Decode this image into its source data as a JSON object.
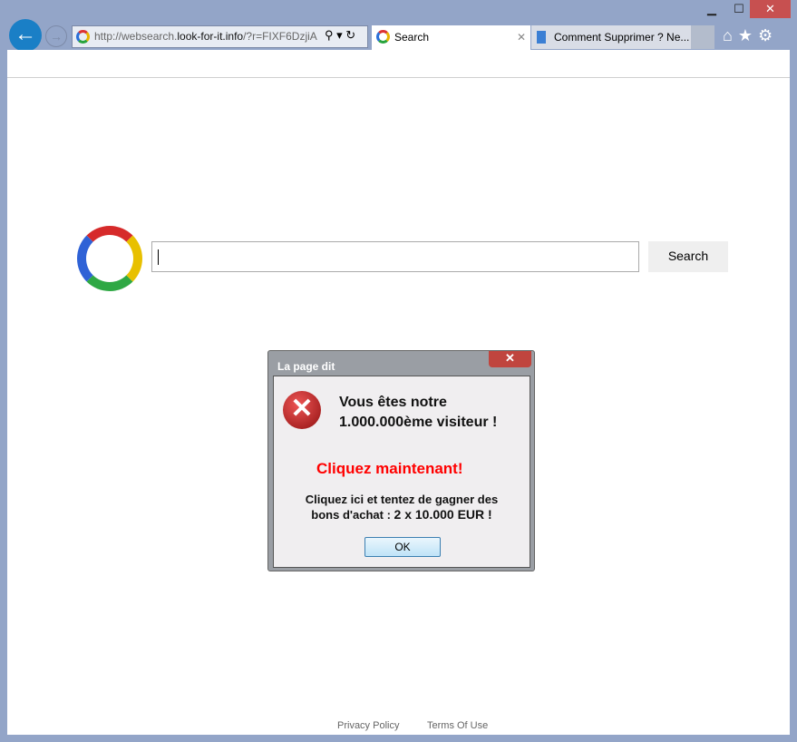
{
  "browser": {
    "minimize": "▁",
    "maximize": "☐",
    "close": "✕",
    "back_icon": "arrow-left",
    "forward_icon": "arrow-right",
    "url_prefix": "http://websearch.",
    "url_domain": "look-for-it.info",
    "url_rest": "/?r=FIXF6DzjiA",
    "tabs": [
      {
        "label": "Search",
        "close": "✕"
      },
      {
        "label": "Comment Supprimer ? Ne..."
      }
    ]
  },
  "page": {
    "search_button": "Search",
    "search_value": "",
    "footer": [
      "Privacy Policy",
      "Terms Of Use"
    ]
  },
  "dialog": {
    "title": "La page dit",
    "close": "✕",
    "line1": "Vous êtes notre",
    "line2": "1.000.000ème visiteur !",
    "cta": "Cliquez maintenant!",
    "body1": "Cliquez ici et tentez de gagner des",
    "body2a": "bons d'achat : ",
    "body2b": "2 x 10.000 EUR !",
    "ok": "OK",
    "cta_color": "#ff0000"
  }
}
